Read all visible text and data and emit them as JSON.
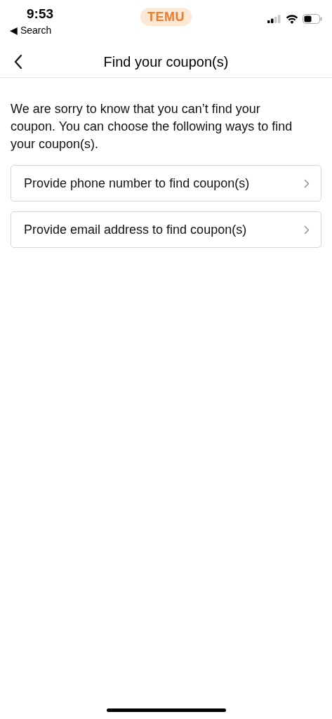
{
  "status_bar": {
    "time": "9:53",
    "back_app": "◀ Search",
    "badge": "TEMU"
  },
  "header": {
    "title": "Find your coupon(s)"
  },
  "message": "We are sorry to know that you can’t find your coupon. You can choose the following ways to find your coupon(s).",
  "options": [
    {
      "label": "Provide phone number to find coupon(s)"
    },
    {
      "label": "Provide email address to find coupon(s)"
    }
  ]
}
